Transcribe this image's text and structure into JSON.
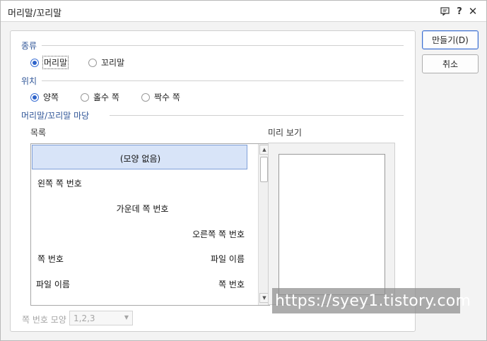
{
  "window": {
    "title": "머리말/꼬리말",
    "icons": [
      "help-window-icon",
      "question-icon",
      "close-icon"
    ]
  },
  "kind": {
    "title": "종류",
    "options": [
      {
        "label": "머리말",
        "checked": true
      },
      {
        "label": "꼬리말",
        "checked": false
      }
    ]
  },
  "position": {
    "title": "위치",
    "options": [
      {
        "label": "양쪽",
        "checked": true
      },
      {
        "label": "홀수 쪽",
        "checked": false
      },
      {
        "label": "짝수 쪽",
        "checked": false
      }
    ]
  },
  "field": {
    "title": "머리말/꼬리말 마당",
    "list_label": "목록",
    "preview_label": "미리 보기",
    "items": [
      {
        "left": "",
        "center": "(모양 없음)",
        "right": "",
        "selected": true
      },
      {
        "left": "왼쪽 쪽 번호",
        "center": "",
        "right": ""
      },
      {
        "left": "",
        "center": "가운데 쪽 번호",
        "right": ""
      },
      {
        "left": "",
        "center": "",
        "right": "오른쪽 쪽 번호"
      },
      {
        "left": "쪽 번호",
        "center": "",
        "right": "파일 이름"
      },
      {
        "left": "파일 이름",
        "center": "",
        "right": "쪽 번호"
      }
    ]
  },
  "page_number_style": {
    "label": "쪽 번호 모양",
    "value": "1,2,3"
  },
  "buttons": {
    "create": "만들기(D)",
    "cancel": "취소"
  },
  "watermark": "https://syey1.tistory.com",
  "colors": {
    "accent": "#2e63c9",
    "section_title": "#2f5597",
    "selected_row": "#d8e4f8"
  }
}
